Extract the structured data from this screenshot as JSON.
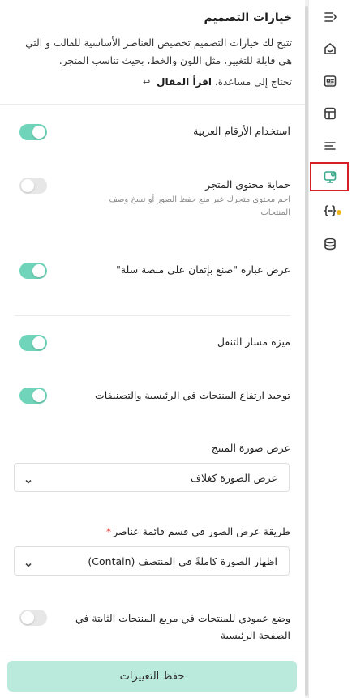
{
  "header": {
    "title": "خيارات التصميم",
    "description": "تتيح لك خيارات التصميم تخصيص العناصر الأساسية للقالب و التي هي قابلة للتغيير، مثل اللون والخط، بحيث تناسب المتجر.",
    "help_prefix": "تحتاج إلى مساعدة،",
    "help_link": "اقرأ المقال"
  },
  "settings": [
    {
      "label": "استخدام الأرقام العربية",
      "enabled": true
    },
    {
      "label": "حماية محتوى المتجر",
      "sub": "احم محتوى متجرك عبر منع حفظ الصور أو نسخ وصف المنتجات",
      "enabled": false
    },
    {
      "label": "عرض عبارة \"صنع بإتقان على منصة سلة\"",
      "enabled": true
    },
    {
      "label": "ميزة مسار التنقل",
      "enabled": true
    },
    {
      "label": "توحيد ارتفاع المنتجات في الرئيسية والتصنيفات",
      "enabled": true
    }
  ],
  "image_display": {
    "label": "عرض صورة المنتج",
    "value": "عرض الصورة كغلاف"
  },
  "list_image_mode": {
    "label": "طريقة عرض الصور في قسم قائمة عناصر",
    "required_mark": "*",
    "value": "اظهار الصورة كاملةً في المنتصف (Contain)"
  },
  "vertical_mode": {
    "label": "وضع عمودي للمنتجات في مربع المنتجات الثابتة في الصفحة الرئيسية",
    "enabled": false
  },
  "footer": {
    "save_label": "حفظ التغييرات"
  },
  "rail_icons": [
    "menu-collapse-icon",
    "home-icon",
    "layout-card-icon",
    "pages-icon",
    "list-icon",
    "design-settings-icon",
    "code-braces-icon",
    "database-icon"
  ],
  "colors": {
    "accent": "#6fd4b9",
    "save_button": "#b9eadb",
    "highlight": "#d81f26",
    "notification_dot": "#f2b51f"
  }
}
